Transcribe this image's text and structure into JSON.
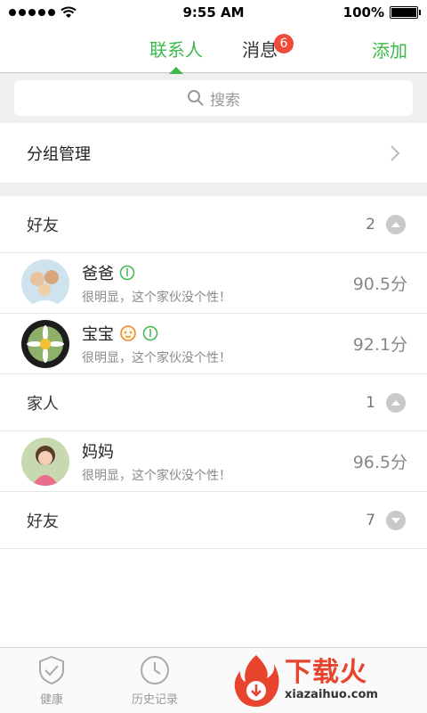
{
  "status_bar": {
    "time": "9:55 AM",
    "battery": "100%"
  },
  "nav": {
    "tabs": [
      {
        "label": "联系人"
      },
      {
        "label": "消息",
        "badge": "6"
      }
    ],
    "add_label": "添加"
  },
  "search": {
    "placeholder": "搜索"
  },
  "group_management": {
    "label": "分组管理"
  },
  "groups": [
    {
      "name": "好友",
      "count": "2",
      "expanded": true,
      "contacts": [
        {
          "name": "爸爸",
          "signature": "很明显，这个家伙没个性！",
          "score": "90.5分"
        },
        {
          "name": "宝宝",
          "signature": "很明显，这个家伙没个性！",
          "score": "92.1分"
        }
      ]
    },
    {
      "name": "家人",
      "count": "1",
      "expanded": true,
      "contacts": [
        {
          "name": "妈妈",
          "signature": "很明显，这个家伙没个性！",
          "score": "96.5分"
        }
      ]
    },
    {
      "name": "好友",
      "count": "7",
      "expanded": false
    }
  ],
  "bottom_nav": [
    {
      "label": "健康"
    },
    {
      "label": "历史记录"
    }
  ],
  "watermark": {
    "title": "下载火",
    "subtitle": "xiazaihuo.com"
  },
  "colors": {
    "accent": "#3cb94a",
    "badge": "#f04a3a",
    "watermark": "#e8432c"
  }
}
